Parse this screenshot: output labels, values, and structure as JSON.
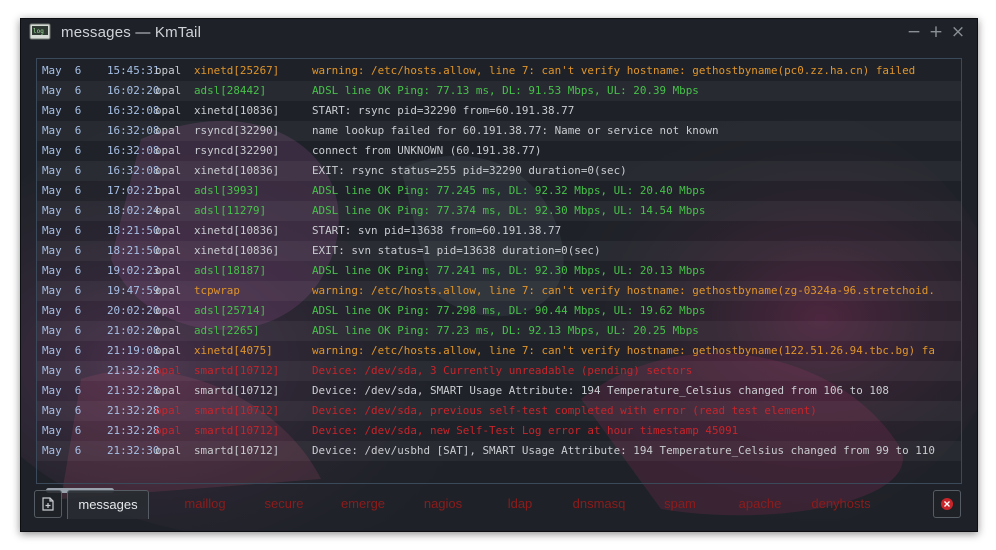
{
  "window": {
    "title": "messages — KmTail",
    "app_icon": "terminal-icon",
    "controls": [
      "minimize-icon",
      "maximize-icon",
      "close-icon"
    ]
  },
  "colors": {
    "date": "#a7c0e6",
    "host": "#c9ccd0",
    "normal": "#c9ccd0",
    "warning": "#e0952a",
    "ok": "#47c14a",
    "error": "#c8242a",
    "tab_inactive": "#8e1b1b"
  },
  "log": {
    "rows": [
      {
        "date": "May  6",
        "time": "15:45:31",
        "host": "opal",
        "proc": "xinetd[25267]",
        "msg": "warning: /etc/hosts.allow, line 7: can't verify hostname: gethostbyname(pc0.zz.ha.cn) failed",
        "level": "warning"
      },
      {
        "date": "May  6",
        "time": "16:02:20",
        "host": "opal",
        "proc": "adsl[28442]",
        "msg": "ADSL line OK Ping: 77.13 ms, DL: 91.53 Mbps, UL: 20.39 Mbps",
        "level": "ok"
      },
      {
        "date": "May  6",
        "time": "16:32:08",
        "host": "opal",
        "proc": "xinetd[10836]",
        "msg": "START: rsync pid=32290 from=60.191.38.77",
        "level": "normal"
      },
      {
        "date": "May  6",
        "time": "16:32:08",
        "host": "opal",
        "proc": "rsyncd[32290]",
        "msg": "name lookup failed for 60.191.38.77: Name or service not known",
        "level": "normal"
      },
      {
        "date": "May  6",
        "time": "16:32:08",
        "host": "opal",
        "proc": "rsyncd[32290]",
        "msg": "connect from UNKNOWN (60.191.38.77)",
        "level": "normal"
      },
      {
        "date": "May  6",
        "time": "16:32:08",
        "host": "opal",
        "proc": "xinetd[10836]",
        "msg": "EXIT: rsync status=255 pid=32290 duration=0(sec)",
        "level": "normal"
      },
      {
        "date": "May  6",
        "time": "17:02:21",
        "host": "opal",
        "proc": "adsl[3993]",
        "msg": "ADSL line OK Ping: 77.245 ms, DL: 92.32 Mbps, UL: 20.40 Mbps",
        "level": "ok"
      },
      {
        "date": "May  6",
        "time": "18:02:24",
        "host": "opal",
        "proc": "adsl[11279]",
        "msg": "ADSL line OK Ping: 77.374 ms, DL: 92.30 Mbps, UL: 14.54 Mbps",
        "level": "ok"
      },
      {
        "date": "May  6",
        "time": "18:21:50",
        "host": "opal",
        "proc": "xinetd[10836]",
        "msg": "START: svn pid=13638 from=60.191.38.77",
        "level": "normal"
      },
      {
        "date": "May  6",
        "time": "18:21:50",
        "host": "opal",
        "proc": "xinetd[10836]",
        "msg": "EXIT: svn status=1 pid=13638 duration=0(sec)",
        "level": "normal"
      },
      {
        "date": "May  6",
        "time": "19:02:23",
        "host": "opal",
        "proc": "adsl[18187]",
        "msg": "ADSL line OK Ping: 77.241 ms, DL: 92.30 Mbps, UL: 20.13 Mbps",
        "level": "ok"
      },
      {
        "date": "May  6",
        "time": "19:47:59",
        "host": "opal",
        "proc": "tcpwrap",
        "msg": "warning: /etc/hosts.allow, line 7: can't verify hostname: gethostbyname(zg-0324a-96.stretchoid.",
        "level": "warning"
      },
      {
        "date": "May  6",
        "time": "20:02:20",
        "host": "opal",
        "proc": "adsl[25714]",
        "msg": "ADSL line OK Ping: 77.298 ms, DL: 90.44 Mbps, UL: 19.62 Mbps",
        "level": "ok"
      },
      {
        "date": "May  6",
        "time": "21:02:20",
        "host": "opal",
        "proc": "adsl[2265]",
        "msg": "ADSL line OK Ping: 77.23 ms, DL: 92.13 Mbps, UL: 20.25 Mbps",
        "level": "ok"
      },
      {
        "date": "May  6",
        "time": "21:19:08",
        "host": "opal",
        "proc": "xinetd[4075]",
        "msg": "warning: /etc/hosts.allow, line 7: can't verify hostname: gethostbyname(122.51.26.94.tbc.bg) fa",
        "level": "warning"
      },
      {
        "date": "May  6",
        "time": "21:32:28",
        "host": "opal",
        "proc": "smartd[10712]",
        "msg": "Device: /dev/sda, 3 Currently unreadable (pending) sectors",
        "level": "error"
      },
      {
        "date": "May  6",
        "time": "21:32:28",
        "host": "opal",
        "proc": "smartd[10712]",
        "msg": "Device: /dev/sda, SMART Usage Attribute: 194 Temperature_Celsius changed from 106 to 108",
        "level": "normal"
      },
      {
        "date": "May  6",
        "time": "21:32:28",
        "host": "opal",
        "proc": "smartd[10712]",
        "msg": "Device: /dev/sda, previous self-test completed with error (read test element)",
        "level": "error"
      },
      {
        "date": "May  6",
        "time": "21:32:28",
        "host": "opal",
        "proc": "smartd[10712]",
        "msg": "Device: /dev/sda, new Self-Test Log error at hour timestamp 45091",
        "level": "error"
      },
      {
        "date": "May  6",
        "time": "21:32:30",
        "host": "opal",
        "proc": "smartd[10712]",
        "msg": "Device: /dev/usbhd [SAT], SMART Usage Attribute: 194 Temperature_Celsius changed from 99 to 110",
        "level": "normal"
      }
    ]
  },
  "tabs": [
    {
      "label": "messages",
      "active": true
    },
    {
      "label": "maillog",
      "active": false
    },
    {
      "label": "secure",
      "active": false
    },
    {
      "label": "emerge",
      "active": false
    },
    {
      "label": "nagios",
      "active": false
    },
    {
      "label": "ldap",
      "active": false
    },
    {
      "label": "dnsmasq",
      "active": false
    },
    {
      "label": "spam",
      "active": false
    },
    {
      "label": "apache",
      "active": false
    },
    {
      "label": "denyhosts",
      "active": false
    }
  ],
  "tabbar": {
    "left_button_icon": "new-tab-icon",
    "right_button_icon": "close-tab-icon"
  }
}
